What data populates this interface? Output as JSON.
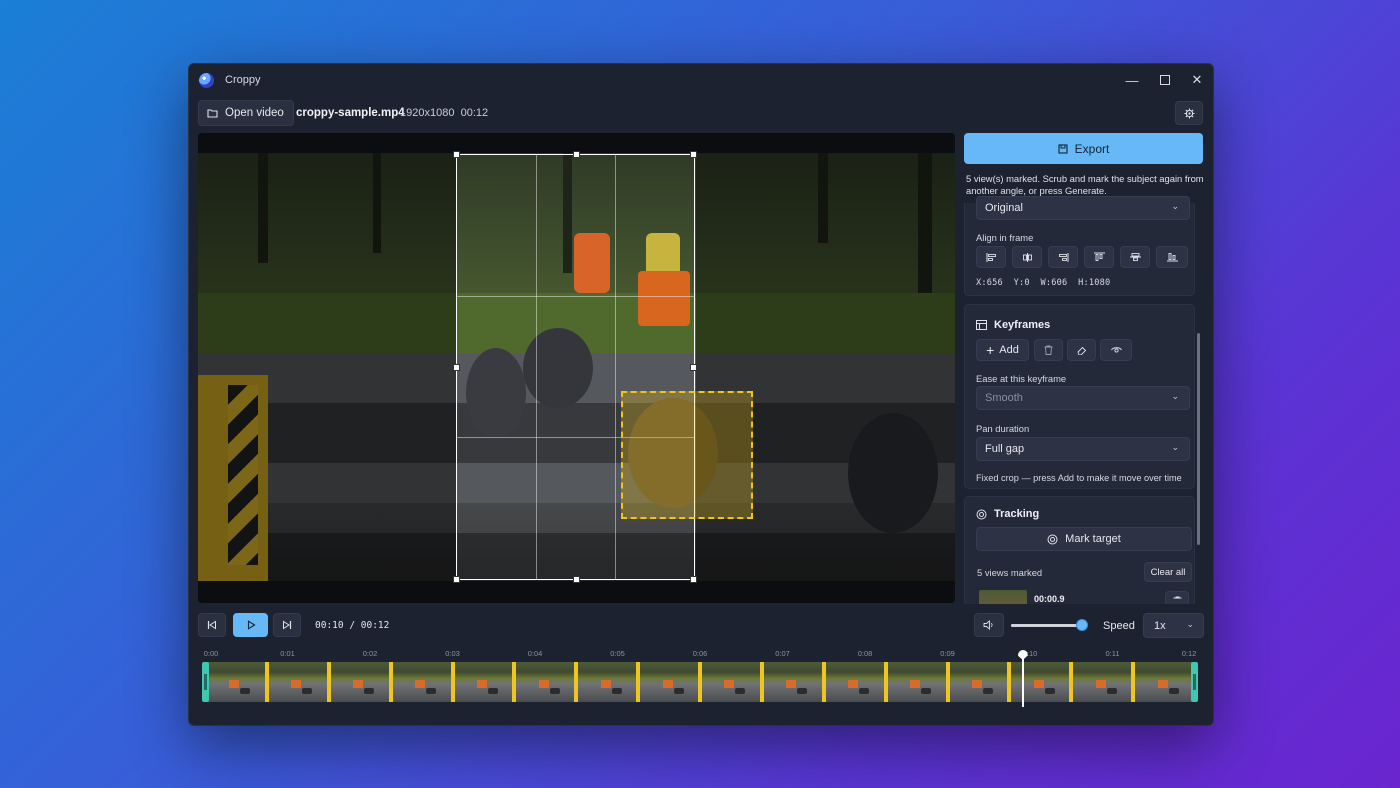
{
  "window": {
    "title": "Croppy"
  },
  "toolbar": {
    "open_label": "Open video",
    "file_name": "croppy-sample.mp4",
    "resolution": "1920x1080",
    "duration": "00:12"
  },
  "panel": {
    "export_label": "Export",
    "export_message": "5 view(s) marked. Scrub and mark the subject again from another angle, or press Generate.",
    "aspect_value": "Original",
    "align_label": "Align in frame",
    "align_icons": [
      "align-left-icon",
      "align-center-h-icon",
      "align-right-icon",
      "align-top-icon",
      "align-center-v-icon",
      "align-bottom-icon"
    ],
    "coords": {
      "x": "X:656",
      "y": "Y:0",
      "w": "W:606",
      "h": "H:1080"
    },
    "keyframes": {
      "title": "Keyframes",
      "add_label": "Add",
      "ease_label": "Ease at this keyframe",
      "ease_value": "Smooth",
      "pan_label": "Pan duration",
      "pan_value": "Full gap",
      "hint": "Fixed crop — press Add to make it move over time"
    },
    "tracking": {
      "title": "Tracking",
      "mark_label": "Mark target",
      "views_count": "5 views marked",
      "clear_label": "Clear all",
      "first_view_time": "00:00.9"
    }
  },
  "transport": {
    "timecode": "00:10 / 00:12",
    "volume_fraction": 0.93,
    "speed_label": "Speed",
    "speed_value": "1x"
  },
  "timeline": {
    "ticks": [
      "0:00",
      "0:01",
      "0:02",
      "0:03",
      "0:04",
      "0:05",
      "0:06",
      "0:07",
      "0:08",
      "0:09",
      "0:10",
      "0:11",
      "0:12"
    ],
    "duration_seconds": 12,
    "playhead_seconds": 9.9,
    "keyframe_seconds": [
      0.75,
      1.5,
      2.25,
      3.0,
      3.75,
      4.5,
      5.25,
      6.0,
      6.75,
      7.5,
      8.25,
      9.0,
      9.75,
      10.5,
      11.25
    ]
  },
  "colors": {
    "accent": "#67b8f7",
    "keyframe": "#efc521",
    "trim_handle": "#3fc7b1",
    "target_box": "#f2c418"
  }
}
